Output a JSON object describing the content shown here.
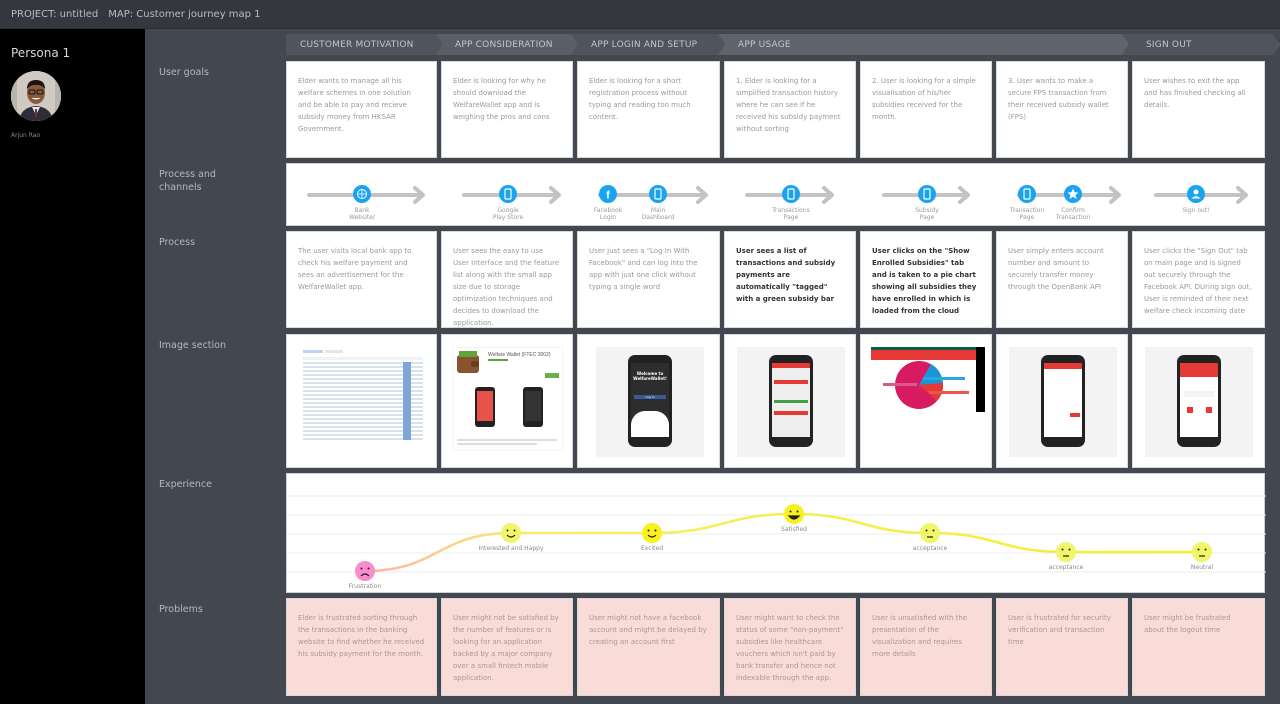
{
  "topbar": {
    "project": "PROJECT: untitled",
    "map": "MAP: Customer journey map 1"
  },
  "persona": {
    "title": "Persona 1",
    "name": "Arjun Rao"
  },
  "row_labels": {
    "user_goals": "User goals",
    "process_channels": "Process and channels",
    "process": "Process",
    "image_section": "Image section",
    "experience": "Experience",
    "problems": "Problems"
  },
  "stages": [
    {
      "label": "CUSTOMER MOTIVATION"
    },
    {
      "label": "APP CONSIDERATION"
    },
    {
      "label": "APP LOGIN AND SETUP"
    },
    {
      "label": "APP USAGE"
    },
    {
      "label": "SIGN OUT"
    }
  ],
  "user_goals": [
    "Elder wants to manage all his welfare schemes in one solution and be able to pay and recieve subsidy money from HKSAR Government.",
    "Elder is looking for why he should download the WelfareWallet app and is weighing the pros and cons",
    "Elder is looking for a short registration process without typing and reading too much content.",
    "1. Elder is looking for a simplified transaction history where he can see if he received his subsidy payment without sorting",
    "2. User is looking for a simple visualisation of his/her subsidies received for the month.",
    "3. User wants to make a secure FPS transaction from their received subsidy wallet (FPS)",
    "User wishes to exit the app and has finished checking all details."
  ],
  "channels": [
    {
      "icon": "globe-icon",
      "label_line1": "Bank",
      "label_line2": "Website/"
    },
    {
      "icon": "phone-icon",
      "label_line1": "Google",
      "label_line2": "Play Store"
    },
    {
      "icon": "facebook-icon",
      "label_line1": "Facebook",
      "label_line2": "Login"
    },
    {
      "icon": "phone-icon",
      "label_line1": "Main",
      "label_line2": "Dashboard"
    },
    {
      "icon": "phone-icon",
      "label_line1": "Transactions",
      "label_line2": "Page"
    },
    {
      "icon": "phone-icon",
      "label_line1": "Subsidy",
      "label_line2": "Page"
    },
    {
      "icon": "phone-icon",
      "label_line1": "Transaction",
      "label_line2": "Page"
    },
    {
      "icon": "star-icon",
      "label_line1": "Confirm",
      "label_line2": "Transaction"
    },
    {
      "icon": "user-icon",
      "label_line1": "Sign out!",
      "label_line2": ""
    }
  ],
  "process": [
    {
      "text": "The user visits local bank app to check his welfare payment and sees an advertisement for the WelfareWallet app.",
      "bold": false
    },
    {
      "text": "User sees the easy to use User Interface and the feature list along with the small app size due to storage optimization techniques and decides to download the application.",
      "bold": false
    },
    {
      "text": "User just sees a \"Log In With Facebook\" and can log into the app with just one click without typing a single word",
      "bold": false
    },
    {
      "text": "User sees a list of transactions and subsidy payments are automatically \"tagged\" with a green subsidy bar",
      "bold": true
    },
    {
      "text": "User clicks on the \"Show Enrolled Subsidies\" tab and is taken to a pie chart showing all subsidies they have enrolled in which is loaded from the cloud",
      "bold": true
    },
    {
      "text": "User simply enters account number and amount to securely transfer money through the OpenBank API",
      "bold": false
    },
    {
      "text": "User clicks the \"Sign Out\" tab on main page and is signed out securely through the Facebook API. DUring sign out, User is reminded of their next welfare check incoming date",
      "bold": false
    }
  ],
  "images": {
    "store_title": "Welfare Wallet (FTEC 3002)",
    "welcome_line1": "Welcome to",
    "welcome_line2": "WelfareWallet!",
    "login_button": "Log in"
  },
  "experience": [
    {
      "label": "Frustration",
      "level": 1,
      "mood": "sad"
    },
    {
      "label": "Interested and Happy",
      "level": 3,
      "mood": "content"
    },
    {
      "label": "Excited",
      "level": 3,
      "mood": "happy"
    },
    {
      "label": "Satisfied",
      "level": 4,
      "mood": "very-happy"
    },
    {
      "label": "acceptance",
      "level": 3,
      "mood": "neutral"
    },
    {
      "label": "acceptance",
      "level": 2,
      "mood": "neutral"
    },
    {
      "label": "Neutral",
      "level": 2,
      "mood": "neutral"
    }
  ],
  "problems": [
    "Elder is frustrated sorting through the transactions in the banking website to find whether he received his subsidy payment for the month.",
    "User might not be satisfied by the number of features or is looking for an application backed by a major company over a small fintech mobile application.",
    "User might not have a facebook account and might be delayed by creating an account first",
    "User might want to check the status of some \"non-payment\" subsidies like healthcare vouchers which isn't paid by bank transfer and hence not indexable through the app.",
    "User is unsatisfied with the presentation of the visualization and requires more details",
    "User is frustrated for security verification and transaction time",
    "User might be frustrated about the logout time"
  ],
  "colors": {
    "channel_icon": "#1aa3f0",
    "arrow": "#c3c3c3",
    "problem_bg": "#f9dcd7",
    "sad_face": "#f98ccb",
    "happy_face": "#f7f21e",
    "line_yellow": "#f3f04a"
  }
}
